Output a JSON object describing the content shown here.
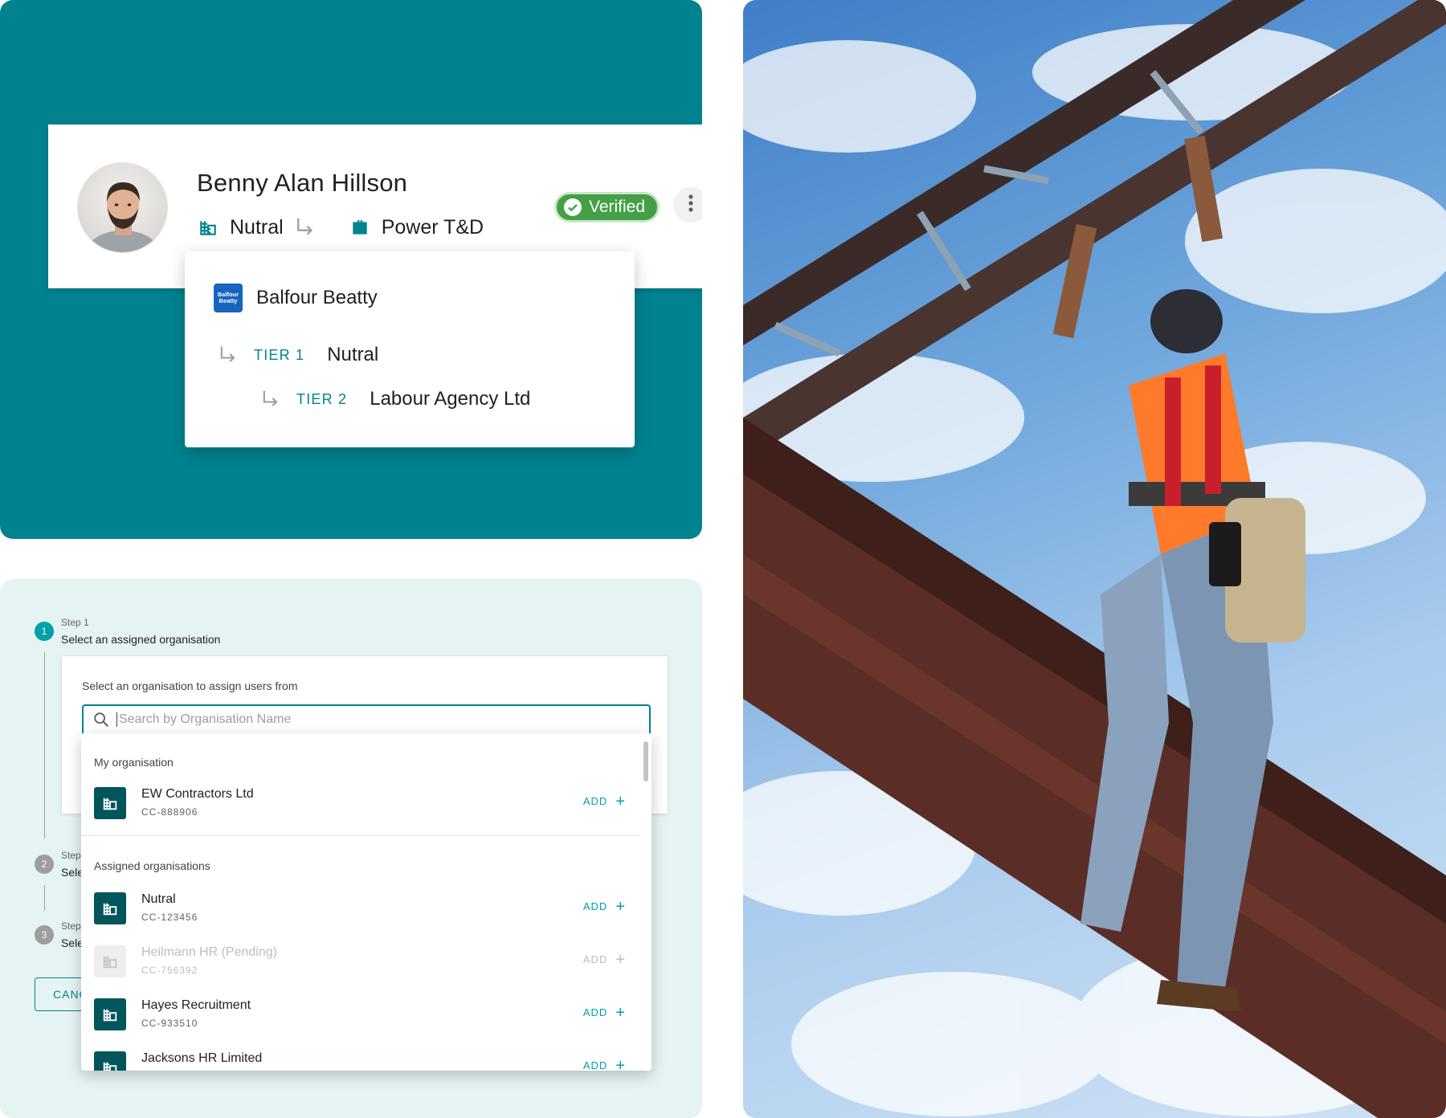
{
  "profile": {
    "name": "Benny Alan Hillson",
    "company": "Nutral",
    "division": "Power T&D",
    "badge": "Verified",
    "icons": [
      "building-icon",
      "subdirectory-arrow-icon",
      "briefcase-icon",
      "check-circle-icon",
      "more-vert-icon"
    ]
  },
  "org_popup": {
    "logo_text": "Balfour Beatty",
    "title": "Balfour Beatty",
    "tiers": [
      {
        "label": "TIER 1",
        "value": "Nutral"
      },
      {
        "label": "TIER 2",
        "value": "Labour Agency Ltd"
      }
    ]
  },
  "stepper": {
    "steps": [
      {
        "number": "1",
        "label": "Step 1",
        "description": "Select an assigned organisation"
      },
      {
        "number": "2",
        "label": "Step",
        "description": "Sele"
      },
      {
        "number": "3",
        "label": "Step",
        "description": "Sele"
      }
    ],
    "card_hint": "Select an organisation to assign users from",
    "search_placeholder": "Search by Organisation Name",
    "cancel_label": "CANC"
  },
  "dropdown": {
    "my_org_heading": "My organisation",
    "my_org": [
      {
        "name": "EW Contractors Ltd",
        "code": "CC-888906",
        "action": "ADD",
        "pending": false
      }
    ],
    "assigned_heading": "Assigned organisations",
    "assigned": [
      {
        "name": "Nutral",
        "code": "CC-123456",
        "action": "ADD",
        "pending": false
      },
      {
        "name": "Heilmann HR (Pending)",
        "code": "CC-756392",
        "action": "ADD",
        "pending": true
      },
      {
        "name": "Hayes Recruitment",
        "code": "CC-933510",
        "action": "ADD",
        "pending": false
      },
      {
        "name": "Jacksons HR Limited",
        "code": "",
        "action": "ADD",
        "pending": false
      }
    ]
  },
  "colors": {
    "teal": "#00838f",
    "teal_dark": "#01565b",
    "accent": "#00a1a7",
    "verified_green": "#43a047",
    "light_panel": "#e6f3f3"
  }
}
